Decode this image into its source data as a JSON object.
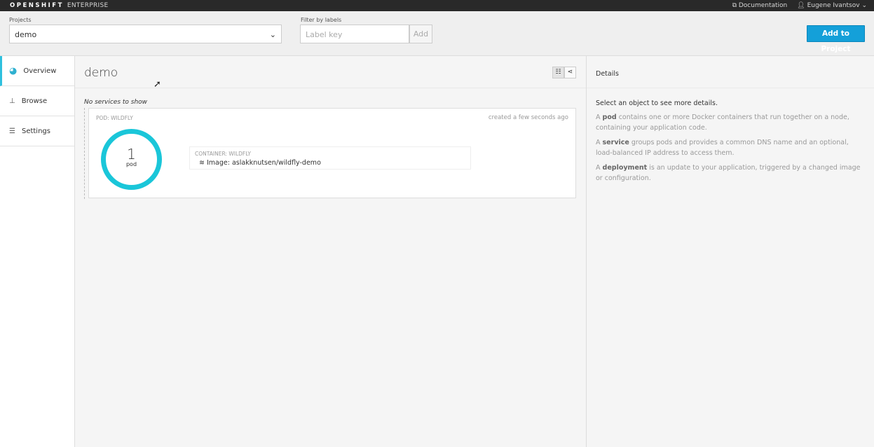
{
  "topbar": {
    "brand_bold": "OPENSHIFT",
    "brand_light": "ENTERPRISE",
    "documentation": "Documentation",
    "user": "Eugene Ivantsov"
  },
  "header": {
    "projects_label": "Projects",
    "project_value": "demo",
    "filter_label": "Filter by labels",
    "label_placeholder": "Label key",
    "add": "Add",
    "add_to_project": "Add to Project"
  },
  "sidebar": {
    "items": [
      {
        "label": "Overview"
      },
      {
        "label": "Browse"
      },
      {
        "label": "Settings"
      }
    ]
  },
  "main": {
    "title": "demo",
    "no_services": "No services to show",
    "pod": {
      "label": "POD: WILDFLY",
      "created": "created a few seconds ago",
      "count": "1",
      "unit": "pod",
      "container_label": "CONTAINER: WILDFLY",
      "image": "Image: aslakknutsen/wildfly-demo"
    }
  },
  "details": {
    "title": "Details",
    "select": "Select an object to see more details.",
    "p1a": "A ",
    "p1b": "pod",
    "p1c": " contains one or more Docker containers that run together on a node, containing your application code.",
    "p2a": "A ",
    "p2b": "service",
    "p2c": " groups pods and provides a common DNS name and an optional, load-balanced IP address to access them.",
    "p3a": "A ",
    "p3b": "deployment",
    "p3c": " is an update to your application, triggered by a changed image or configuration."
  }
}
